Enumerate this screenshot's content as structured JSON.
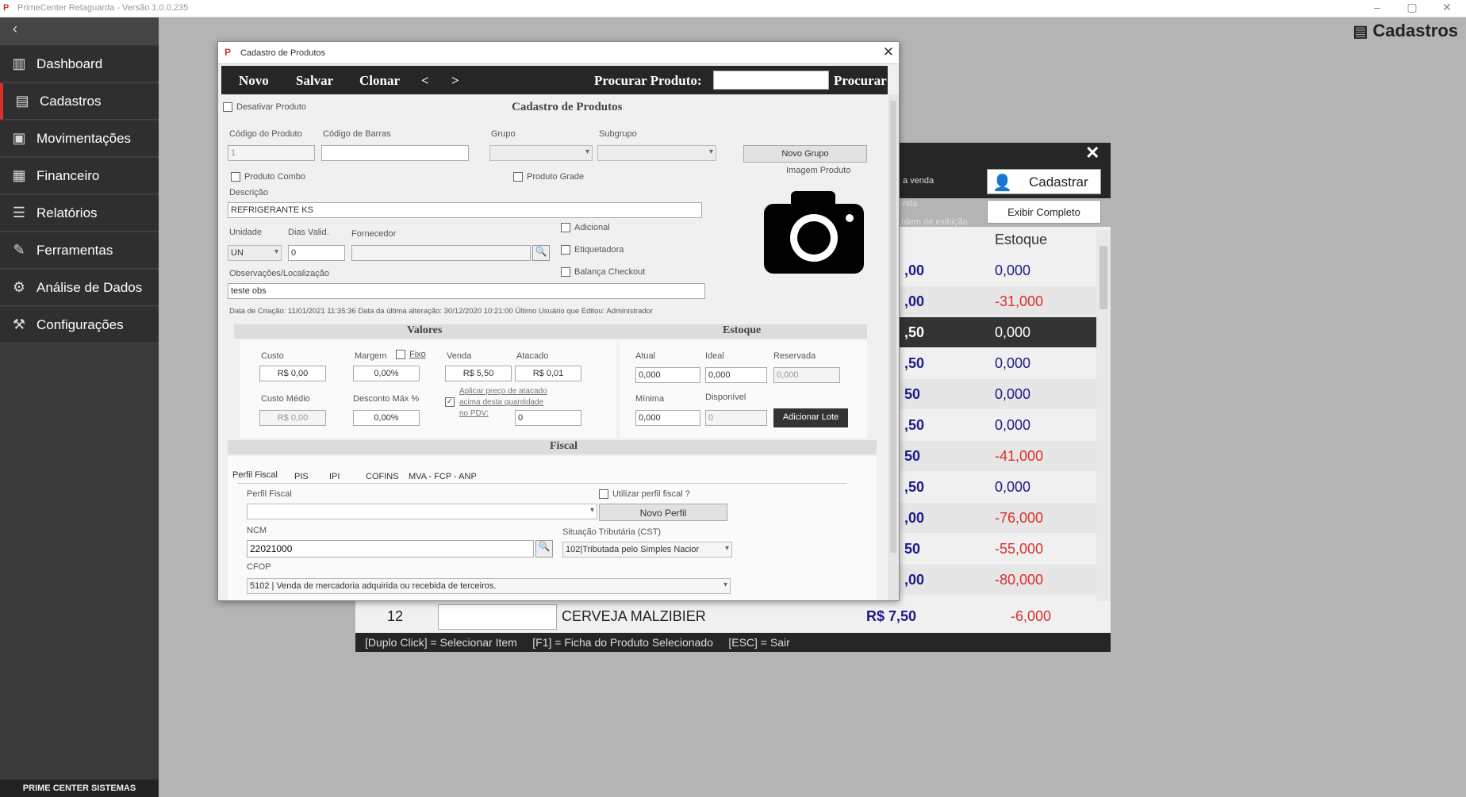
{
  "app": {
    "title": "PrimeCenter Retaguarda - Versão 1.0.0.235",
    "page_title": "Cadastros",
    "footer": "PRIME CENTER SISTEMAS"
  },
  "sidebar": {
    "items": [
      {
        "label": "Dashboard",
        "icon": "chart-icon"
      },
      {
        "label": "Cadastros",
        "icon": "register-icon"
      },
      {
        "label": "Movimentações",
        "icon": "movements-icon"
      },
      {
        "label": "Financeiro",
        "icon": "finance-icon"
      },
      {
        "label": "Relatórios",
        "icon": "reports-icon"
      },
      {
        "label": "Ferramentas",
        "icon": "tools-icon"
      },
      {
        "label": "Análise de Dados",
        "icon": "gear-icon"
      },
      {
        "label": "Configurações",
        "icon": "settings-icon"
      }
    ]
  },
  "background": {
    "labels": [
      "a venda",
      "nda",
      "rdem de exibição"
    ],
    "cadastrar": "Cadastrar",
    "exibir": "Exibir Completo",
    "col_estoque": "Estoque",
    "rows": [
      {
        "price": ",00",
        "qty": "0,000",
        "neg": false
      },
      {
        "price": ",00",
        "qty": "-31,000",
        "neg": true
      },
      {
        "price": ",50",
        "qty": "0,000",
        "neg": false
      },
      {
        "price": ",50",
        "qty": "0,000",
        "neg": false
      },
      {
        "price": "50",
        "qty": "0,000",
        "neg": false
      },
      {
        "price": ",50",
        "qty": "0,000",
        "neg": false
      },
      {
        "price": "50",
        "qty": "-41,000",
        "neg": true
      },
      {
        "price": ",50",
        "qty": "0,000",
        "neg": false
      },
      {
        "price": ",00",
        "qty": "-76,000",
        "neg": true
      },
      {
        "price": "50",
        "qty": "-55,000",
        "neg": true
      },
      {
        "price": ",00",
        "qty": "-80,000",
        "neg": true
      }
    ],
    "row12": {
      "num": "12",
      "name": "CERVEJA MALZIBIER",
      "price": "R$ 7,50",
      "qty": "-6,000"
    },
    "hint": "[Duplo Click] = Selecionar Item     [F1] = Ficha do Produto Selecionado     [ESC] = Sair"
  },
  "dialog": {
    "title": "Cadastro de Produtos",
    "toolbar": {
      "novo": "Novo",
      "salvar": "Salvar",
      "clonar": "Clonar",
      "prev": "<",
      "next": ">",
      "search_label": "Procurar Produto:",
      "search_value": "",
      "procurar": "Procurar"
    },
    "desativar": "Desativar Produto",
    "heading": "Cadastro de Produtos",
    "codigo_label": "Código do Produto",
    "codigo_value": "1",
    "barras_label": "Código de Barras",
    "barras_value": "",
    "grupo_label": "Grupo",
    "subgrupo_label": "Subgrupo",
    "novo_grupo": "Novo Grupo",
    "imagem_label": "Imagem Produto",
    "produto_combo": "Produto Combo",
    "produto_grade": "Produto Grade",
    "descricao_label": "Descrição",
    "descricao_value": "REFRIGERANTE KS",
    "unidade_label": "Unidade",
    "unidade_value": "UN",
    "dias_label": "Dias Valid.",
    "dias_value": "0",
    "fornecedor_label": "Fornecedor",
    "fornecedor_value": "",
    "adicional": "Adicional",
    "etiquetadora": "Etiquetadora",
    "balanca": "Balança Checkout",
    "obs_label": "Observações/Localização",
    "obs_value": "teste obs",
    "meta": "Data de Criação: 11/01/2021 11:35:36   Data da última alteração: 30/12/2020 10:21:00   Último Usuário que Editou: Administrador",
    "valores": {
      "heading": "Valores",
      "custo_label": "Custo",
      "custo_value": "R$ 0,00",
      "margem_label": "Margem",
      "fixo": "Fixo",
      "margem_value": "0,00%",
      "venda_label": "Venda",
      "venda_value": "R$ 5,50",
      "atacado_label": "Atacado",
      "atacado_value": "R$ 0,01",
      "custo_medio_label": "Custo Médio",
      "custo_medio_value": "R$ 0,00",
      "desconto_label": "Desconto Máx %",
      "desconto_value": "0,00%",
      "aplicar_line1": "Aplicar preço de atacado",
      "aplicar_line2": "acima desta quantidade",
      "aplicar_line3": "no PDV:",
      "aplicar_value": "0"
    },
    "estoque": {
      "heading": "Estoque",
      "atual_label": "Atual",
      "atual_value": "0,000",
      "ideal_label": "Ideal",
      "ideal_value": "0,000",
      "reservada_label": "Reservada",
      "reservada_value": "0,000",
      "minima_label": "Mínima",
      "minima_value": "0,000",
      "disponivel_label": "Disponível",
      "disponivel_value": "0",
      "adicionar_lote": "Adicionar Lote"
    },
    "fiscal": {
      "heading": "Fiscal",
      "tabs": [
        "Perfil Fiscal",
        "PIS",
        "IPI",
        "COFINS",
        "MVA - FCP - ANP"
      ],
      "perfil_label": "Perfil Fiscal",
      "perfil_value": "",
      "utilizar": "Utilizar perfil fiscal ?",
      "novo_perfil": "Novo Perfil",
      "ncm_label": "NCM",
      "ncm_value": "22021000",
      "cst_label": "Situação Tributária (CST)",
      "cst_value": "102|Tributada pelo Simples Nacior",
      "cfop_label": "CFOP",
      "cfop_value": "5102 | Venda de mercadoria adquirida ou recebida de terceiros."
    }
  }
}
